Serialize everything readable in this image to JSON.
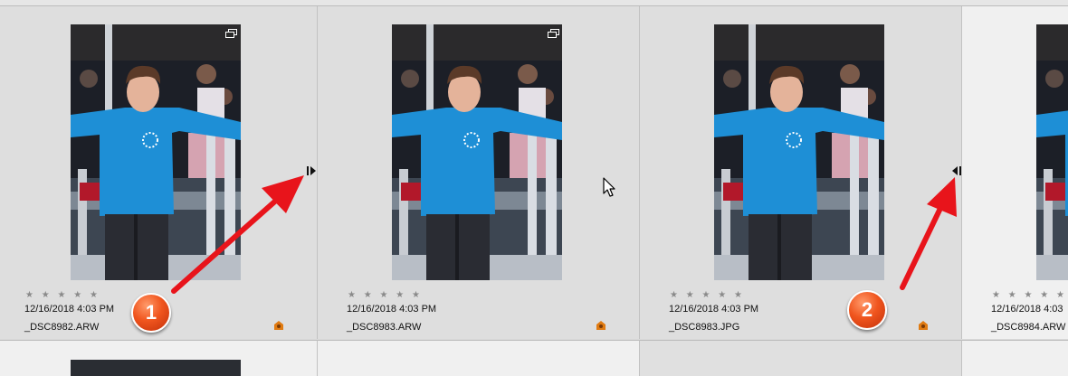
{
  "tiles": [
    {
      "stars": "★ ★ ★ ★ ★",
      "date": "12/16/2018 4:03 PM",
      "filename": "_DSC8982.ARW",
      "stack_icon": "stack-icon",
      "badge": "label-icon"
    },
    {
      "stars": "★ ★ ★ ★ ★",
      "date": "12/16/2018 4:03 PM",
      "filename": "_DSC8983.ARW",
      "stack_icon": "stack-icon",
      "badge": "label-icon"
    },
    {
      "stars": "★ ★ ★ ★ ★",
      "date": "12/16/2018 4:03 PM",
      "filename": "_DSC8983.JPG",
      "badge": "label-icon"
    },
    {
      "stars": "★ ★ ★ ★ ★",
      "date": "12/16/2018 4:03",
      "filename": "_DSC8984.ARW"
    }
  ],
  "callouts": [
    {
      "label": "1"
    },
    {
      "label": "2"
    }
  ],
  "colors": {
    "arrow": "#e8141b",
    "callout": "#f0551e",
    "shirt": "#1e8fd6",
    "badge": "#e07b12"
  }
}
